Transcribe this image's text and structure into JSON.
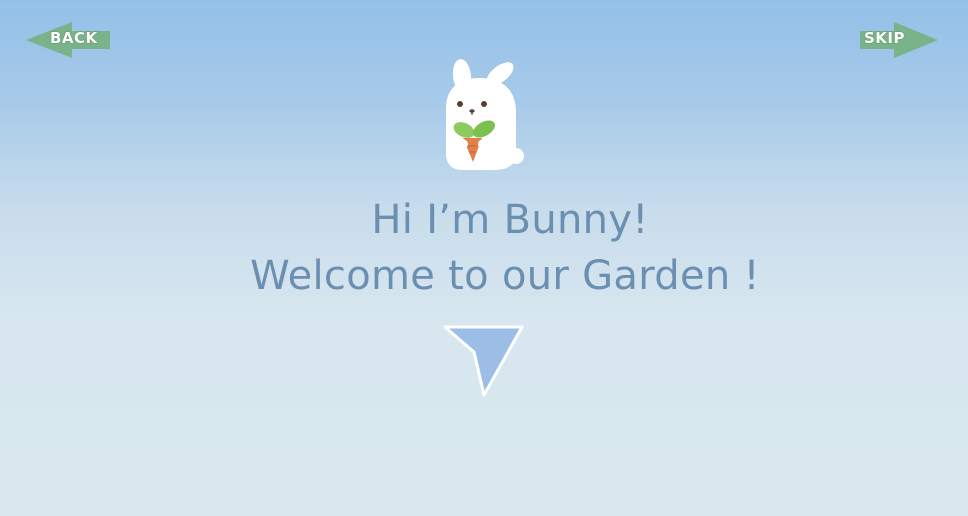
{
  "nav": {
    "back_label": "BACK",
    "skip_label": "SKIP",
    "arrow_color": "#79b389"
  },
  "greeting": {
    "line1": "Hi I’m Bunny!",
    "line2": "Welcome to our Garden !"
  },
  "character": {
    "icon": "bunny-holding-carrot-icon"
  },
  "next": {
    "icon": "down-arrow-icon",
    "color": "#9bbde6"
  }
}
